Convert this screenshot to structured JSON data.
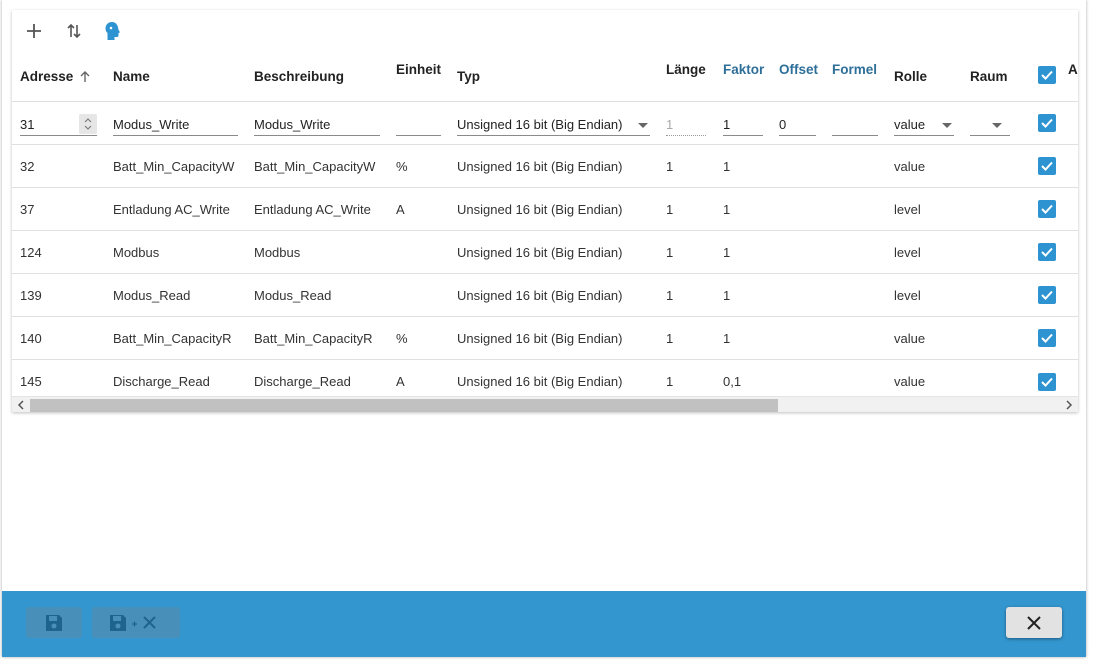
{
  "toolbar": {
    "add_icon": "plus-icon",
    "sort_icon": "swap-vertical-icon",
    "role_icon": "head-icon"
  },
  "columns": {
    "adresse": "Adresse",
    "name": "Name",
    "beschreibung": "Beschreibung",
    "einheit": "Einheit",
    "typ": "Typ",
    "laenge": "Länge",
    "faktor": "Faktor",
    "offset": "Offset",
    "formel": "Formel",
    "rolle": "Rolle",
    "raum": "Raum",
    "extra": "A"
  },
  "edit_row": {
    "adresse": "31",
    "name": "Modus_Write",
    "beschreibung": "Modus_Write",
    "einheit": "",
    "typ": "Unsigned 16 bit (Big Endian)",
    "laenge": "1",
    "faktor": "1",
    "offset": "0",
    "formel": "",
    "rolle": "value",
    "raum": ""
  },
  "rows": [
    {
      "adresse": "32",
      "name": "Batt_Min_CapacityW",
      "beschreibung": "Batt_Min_CapacityW",
      "einheit": "%",
      "typ": "Unsigned 16 bit (Big Endian)",
      "laenge": "1",
      "faktor": "1",
      "rolle": "value"
    },
    {
      "adresse": "37",
      "name": "Entladung AC_Write",
      "beschreibung": "Entladung AC_Write",
      "einheit": "A",
      "typ": "Unsigned 16 bit (Big Endian)",
      "laenge": "1",
      "faktor": "1",
      "rolle": "level"
    },
    {
      "adresse": "124",
      "name": "Modbus",
      "beschreibung": "Modbus",
      "einheit": "",
      "typ": "Unsigned 16 bit (Big Endian)",
      "laenge": "1",
      "faktor": "1",
      "rolle": "level"
    },
    {
      "adresse": "139",
      "name": "Modus_Read",
      "beschreibung": "Modus_Read",
      "einheit": "",
      "typ": "Unsigned 16 bit (Big Endian)",
      "laenge": "1",
      "faktor": "1",
      "rolle": "level"
    },
    {
      "adresse": "140",
      "name": "Batt_Min_CapacityR",
      "beschreibung": "Batt_Min_CapacityR",
      "einheit": "%",
      "typ": "Unsigned 16 bit (Big Endian)",
      "laenge": "1",
      "faktor": "1",
      "rolle": "value"
    },
    {
      "adresse": "145",
      "name": "Discharge_Read",
      "beschreibung": "Discharge_Read",
      "einheit": "A",
      "typ": "Unsigned 16 bit (Big Endian)",
      "laenge": "1",
      "faktor": "0,1",
      "rolle": "value"
    }
  ],
  "footer": {
    "save_icon": "floppy-disk-icon",
    "save_close_icon": "floppy-disk-plus-close-icon",
    "close_icon": "close-icon"
  },
  "colors": {
    "accent": "#3396cf",
    "checkbox": "#2e93d1",
    "header_blue": "#2e6f99"
  }
}
